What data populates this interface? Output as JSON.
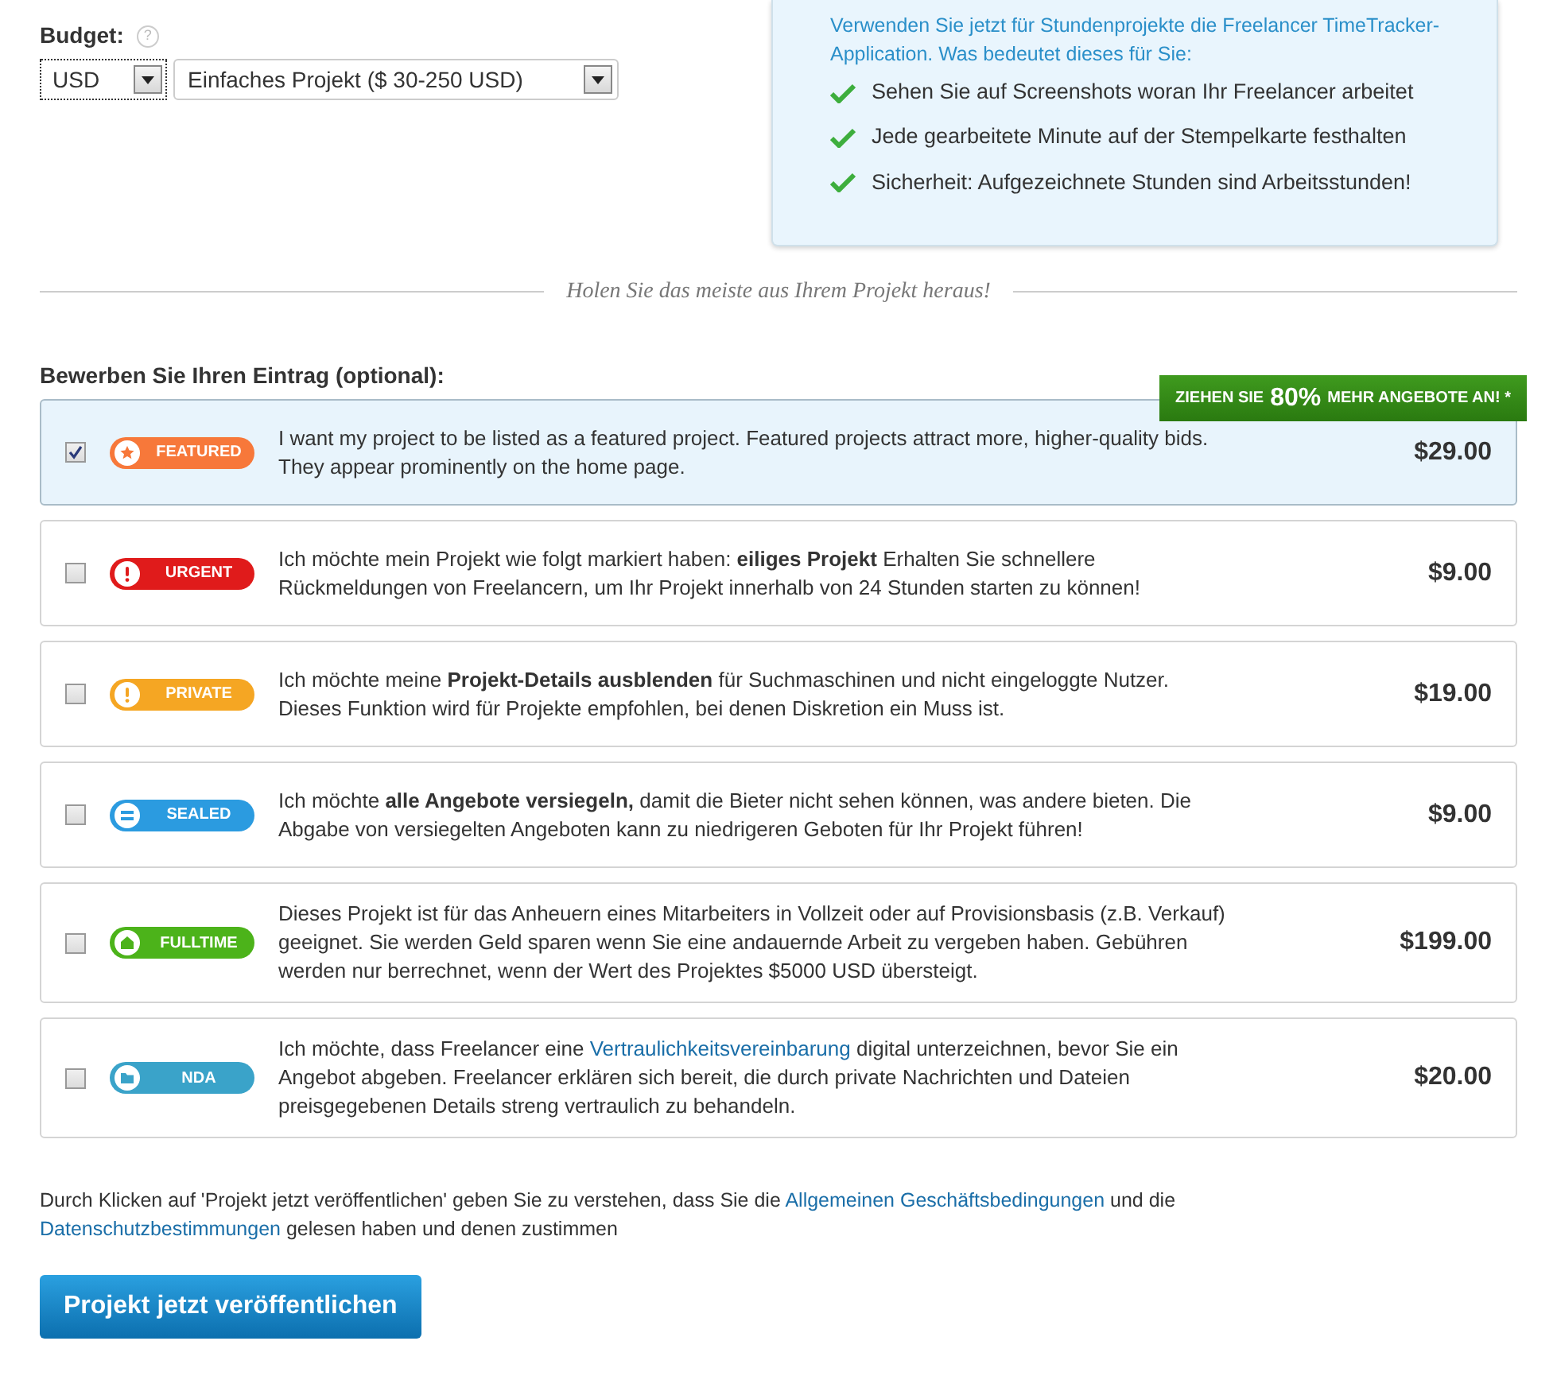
{
  "budget": {
    "label": "Budget:",
    "help": "?",
    "currency": "USD",
    "project_type": "Einfaches Projekt ($ 30-250 USD)"
  },
  "info_box": {
    "intro": "Verwenden Sie jetzt für Stundenprojekte die Freelancer TimeTracker-Application. Was bedeutet dieses für Sie:",
    "points": [
      "Sehen Sie auf Screenshots woran Ihr Freelancer arbeitet",
      "Jede gearbeitete Minute auf der Stempelkarte festhalten",
      "Sicherheit: Aufgezeichnete Stunden sind Arbeitsstunden!"
    ]
  },
  "divider_text": "Holen Sie das meiste aus Ihrem Projekt heraus!",
  "upgrades_heading": "Bewerben Sie Ihren Eintrag (optional):",
  "ribbon": {
    "before": "ZIEHEN SIE",
    "highlight": "80%",
    "after": "MEHR ANGEBOTE AN! *"
  },
  "options": [
    {
      "badge": "FEATURED",
      "kind": "star",
      "color": "#f7783a",
      "checked": true,
      "price": "$29.00",
      "description": [
        {
          "kind": "text",
          "text": "I want my project to be listed as a featured project. Featured projects attract more, higher-quality bids. They appear prominently on the home page."
        }
      ]
    },
    {
      "badge": "URGENT",
      "kind": "alert",
      "color": "#e01b1b",
      "checked": false,
      "price": "$9.00",
      "description": [
        {
          "kind": "text",
          "text": "Ich möchte mein Projekt wie folgt markiert haben: **eiliges Projekt** Erhalten Sie schnellere Rückmeldungen von Freelancern, um Ihr Projekt innerhalb von 24 Stunden starten zu können!"
        }
      ]
    },
    {
      "badge": "PRIVATE",
      "kind": "alert",
      "color": "#f5a623",
      "checked": false,
      "price": "$19.00",
      "description": [
        {
          "kind": "text",
          "text": "Ich möchte meine **Projekt-Details ausblenden** für Suchmaschinen und nicht eingeloggte Nutzer. Dieses Funktion wird für Projekte empfohlen, bei denen Diskretion ein Muss ist."
        }
      ]
    },
    {
      "badge": "SEALED",
      "kind": "seal",
      "color": "#2b9be0",
      "checked": false,
      "price": "$9.00",
      "description": [
        {
          "kind": "text",
          "text": "Ich möchte **alle Angebote versiegeln,** damit die Bieter nicht sehen können, was andere bieten. Die Abgabe von versiegelten Angeboten kann zu niedrigeren Geboten für Ihr Projekt führen!"
        }
      ]
    },
    {
      "badge": "FULLTIME",
      "kind": "house",
      "color": "#4cb31a",
      "checked": false,
      "price": "$199.00",
      "description": [
        {
          "kind": "text",
          "text": "Dieses Projekt ist für das Anheuern eines Mitarbeiters in Vollzeit oder auf Provisionsbasis (z.B. Verkauf) geeignet. Sie werden Geld sparen wenn Sie eine andauernde Arbeit zu vergeben haben. Gebühren werden nur berrechnet, wenn der Wert des Projektes $5000 USD übersteigt."
        }
      ]
    },
    {
      "badge": "NDA",
      "kind": "folder",
      "color": "#3aa3c9",
      "checked": false,
      "price": "$20.00",
      "description": [
        {
          "kind": "text",
          "text": "Ich möchte, dass Freelancer eine "
        },
        {
          "kind": "link",
          "text": "Vertraulichkeitsvereinbarung"
        },
        {
          "kind": "text",
          "text": " digital unterzeichnen, bevor Sie ein Angebot abgeben. Freelancer erklären sich bereit, die durch private Nachrichten und Dateien preisgegebenen Details streng vertraulich zu behandeln."
        }
      ]
    }
  ],
  "terms": [
    {
      "kind": "text",
      "text": "Durch Klicken auf 'Projekt jetzt veröffentlichen' geben Sie zu verstehen, dass Sie die "
    },
    {
      "kind": "link",
      "text": "Allgemeinen Geschäftsbedingungen"
    },
    {
      "kind": "text",
      "text": " und die "
    },
    {
      "kind": "link",
      "text": "Datenschutzbestimmungen"
    },
    {
      "kind": "text",
      "text": " gelesen haben und denen zustimmen"
    }
  ],
  "submit_button": "Projekt jetzt veröffentlichen"
}
